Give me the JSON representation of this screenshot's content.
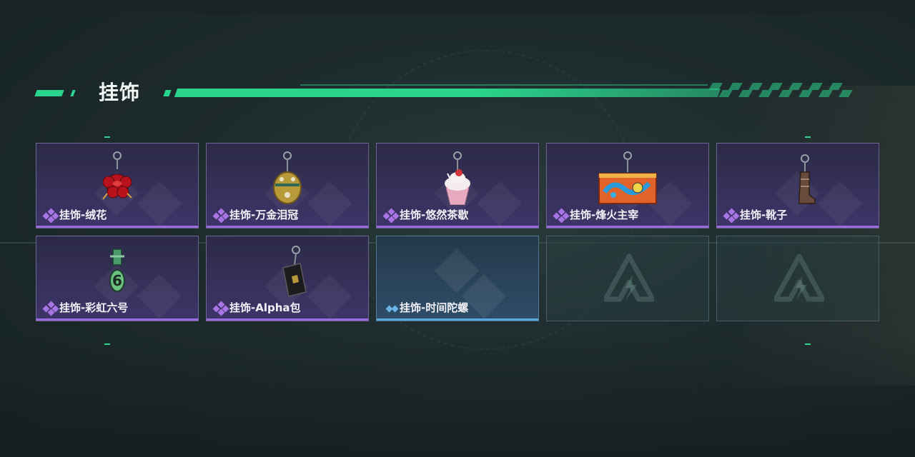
{
  "section": {
    "title": "挂饰"
  },
  "items": [
    {
      "label": "挂饰-绒花",
      "rarity": "purple",
      "icon": "rose-charm-icon"
    },
    {
      "label": "挂饰-万金泪冠",
      "rarity": "purple",
      "icon": "crown-charm-icon"
    },
    {
      "label": "挂饰-悠然茶歇",
      "rarity": "purple",
      "icon": "cupcake-charm-icon"
    },
    {
      "label": "挂饰-烽火主宰",
      "rarity": "purple",
      "icon": "banner-charm-icon"
    },
    {
      "label": "挂饰-靴子",
      "rarity": "purple",
      "icon": "boot-charm-icon"
    },
    {
      "label": "挂饰-彩虹六号",
      "rarity": "purple",
      "icon": "rainbow-six-charm-icon"
    },
    {
      "label": "挂饰-Alpha包",
      "rarity": "purple",
      "icon": "alpha-bag-charm-icon"
    },
    {
      "label": "挂饰-时间陀螺",
      "rarity": "blue",
      "icon": "spinning-top-charm-icon"
    },
    {
      "label": "",
      "rarity": "empty",
      "icon": "game-logo-icon"
    },
    {
      "label": "",
      "rarity": "empty",
      "icon": "game-logo-icon"
    }
  ],
  "colors": {
    "accent": "#2ad48c",
    "purple_rarity": "#9b6cdd",
    "blue_rarity": "#5aa8e0"
  }
}
